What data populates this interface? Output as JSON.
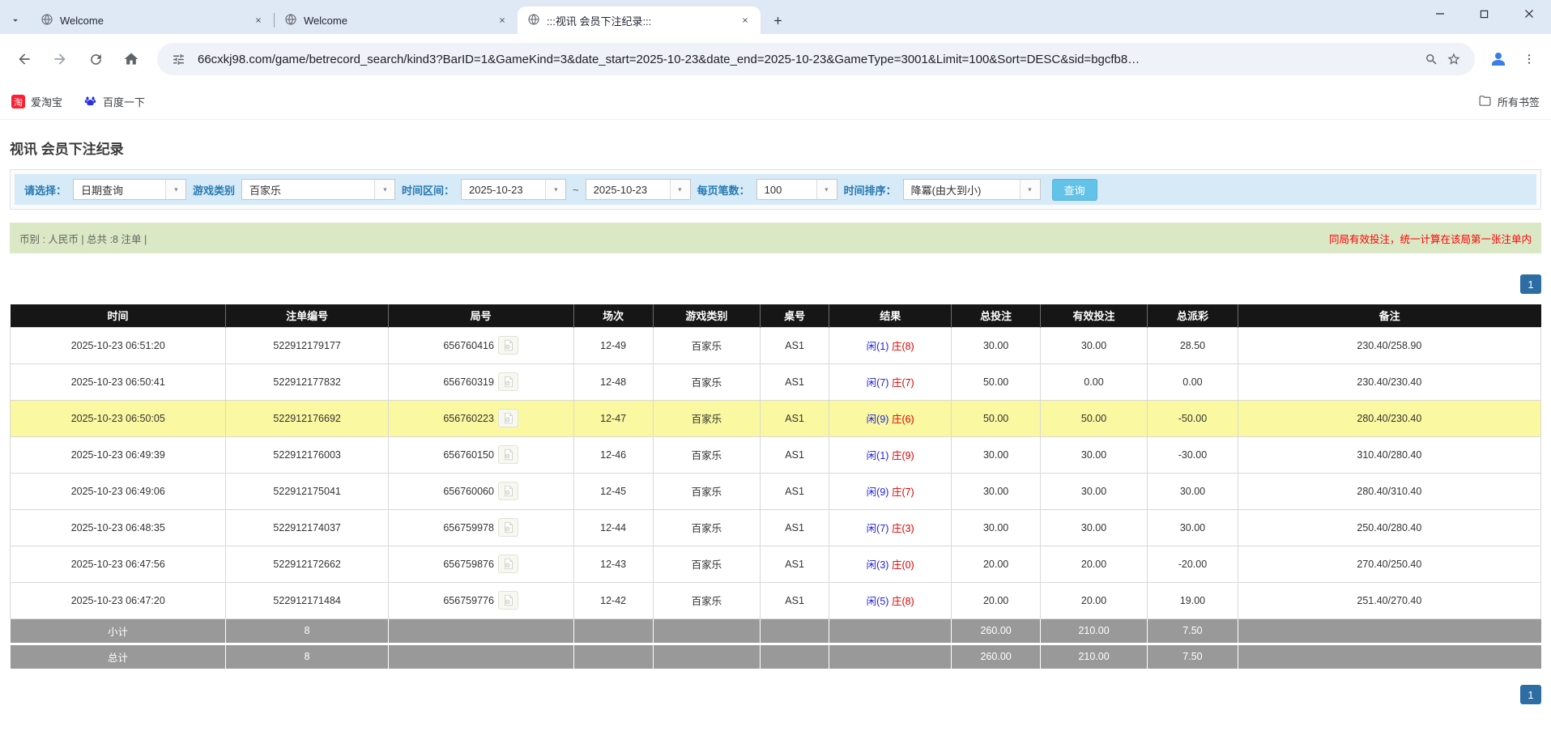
{
  "browser": {
    "tab_list": [
      {
        "title": "Welcome"
      },
      {
        "title": "Welcome"
      },
      {
        "title": ":::视讯 会员下注纪录:::"
      }
    ],
    "url": "66cxkj98.com/game/betrecord_search/kind3?BarID=1&GameKind=3&date_start=2025-10-23&date_end=2025-10-23&GameType=3001&Limit=100&Sort=DESC&sid=bgcfb8…",
    "bookmarks": [
      {
        "label": "爱淘宝",
        "icon_char": "淘"
      },
      {
        "label": "百度一下"
      }
    ],
    "all_bookmarks_label": "所有书签"
  },
  "page": {
    "title": "视讯 会员下注纪录",
    "filters": {
      "select_label": "请选择：",
      "select_value": "日期查询",
      "game_kind_label": "游戏类别",
      "game_kind_value": "百家乐",
      "date_range_label": "时间区间：",
      "date_start": "2025-10-23",
      "date_separator": "~",
      "date_end": "2025-10-23",
      "per_page_label": "每页笔数：",
      "per_page_value": "100",
      "sort_label": "时间排序：",
      "sort_value": "降冪(由大到小)",
      "search_button": "查询"
    },
    "info_bar": {
      "left": "币别 : 人民币 | 总共 :8 注单 |",
      "right": "同局有效投注，统一计算在该局第一张注单内"
    },
    "pagination": "1"
  },
  "table": {
    "headers": [
      "时间",
      "注单编号",
      "局号",
      "场次",
      "游戏类别",
      "桌号",
      "结果",
      "总投注",
      "有效投注",
      "总派彩",
      "备注"
    ],
    "rows": [
      {
        "time": "2025-10-23 06:51:20",
        "bet_id": "522912179177",
        "round": "656760416",
        "session": "12-49",
        "game": "百家乐",
        "table_no": "AS1",
        "result_player": "闲(1)",
        "result_banker": "庄(8)",
        "total_bet": "30.00",
        "valid_bet": "30.00",
        "payout": "28.50",
        "note": "230.40/258.90",
        "highlight": false
      },
      {
        "time": "2025-10-23 06:50:41",
        "bet_id": "522912177832",
        "round": "656760319",
        "session": "12-48",
        "game": "百家乐",
        "table_no": "AS1",
        "result_player": "闲(7)",
        "result_banker": "庄(7)",
        "total_bet": "50.00",
        "valid_bet": "0.00",
        "payout": "0.00",
        "note": "230.40/230.40",
        "highlight": false
      },
      {
        "time": "2025-10-23 06:50:05",
        "bet_id": "522912176692",
        "round": "656760223",
        "session": "12-47",
        "game": "百家乐",
        "table_no": "AS1",
        "result_player": "闲(9)",
        "result_banker": "庄(6)",
        "total_bet": "50.00",
        "valid_bet": "50.00",
        "payout": "-50.00",
        "note": "280.40/230.40",
        "highlight": true
      },
      {
        "time": "2025-10-23 06:49:39",
        "bet_id": "522912176003",
        "round": "656760150",
        "session": "12-46",
        "game": "百家乐",
        "table_no": "AS1",
        "result_player": "闲(1)",
        "result_banker": "庄(9)",
        "total_bet": "30.00",
        "valid_bet": "30.00",
        "payout": "-30.00",
        "note": "310.40/280.40",
        "highlight": false
      },
      {
        "time": "2025-10-23 06:49:06",
        "bet_id": "522912175041",
        "round": "656760060",
        "session": "12-45",
        "game": "百家乐",
        "table_no": "AS1",
        "result_player": "闲(9)",
        "result_banker": "庄(7)",
        "total_bet": "30.00",
        "valid_bet": "30.00",
        "payout": "30.00",
        "note": "280.40/310.40",
        "highlight": false
      },
      {
        "time": "2025-10-23 06:48:35",
        "bet_id": "522912174037",
        "round": "656759978",
        "session": "12-44",
        "game": "百家乐",
        "table_no": "AS1",
        "result_player": "闲(7)",
        "result_banker": "庄(3)",
        "total_bet": "30.00",
        "valid_bet": "30.00",
        "payout": "30.00",
        "note": "250.40/280.40",
        "highlight": false
      },
      {
        "time": "2025-10-23 06:47:56",
        "bet_id": "522912172662",
        "round": "656759876",
        "session": "12-43",
        "game": "百家乐",
        "table_no": "AS1",
        "result_player": "闲(3)",
        "result_banker": "庄(0)",
        "total_bet": "20.00",
        "valid_bet": "20.00",
        "payout": "-20.00",
        "note": "270.40/250.40",
        "highlight": false
      },
      {
        "time": "2025-10-23 06:47:20",
        "bet_id": "522912171484",
        "round": "656759776",
        "session": "12-42",
        "game": "百家乐",
        "table_no": "AS1",
        "result_player": "闲(5)",
        "result_banker": "庄(8)",
        "total_bet": "20.00",
        "valid_bet": "20.00",
        "payout": "19.00",
        "note": "251.40/270.40",
        "highlight": false
      }
    ],
    "subtotal": {
      "label": "小计",
      "count": "8",
      "total_bet": "260.00",
      "valid_bet": "210.00",
      "payout": "7.50"
    },
    "total": {
      "label": "总计",
      "count": "8",
      "total_bet": "260.00",
      "valid_bet": "210.00",
      "payout": "7.50"
    }
  },
  "colors": {
    "header_bg": "#161616",
    "highlight_row": "#faf8a0",
    "info_bar_bg": "#dae8c6",
    "filter_bar_bg": "#d7eaf8",
    "filter_label": "#2779b0",
    "search_button_bg": "#63c2e8",
    "pager_bg": "#2d6da3",
    "sum_row_bg": "#999999",
    "bet_link": "#0066dd",
    "negative": "#ff0000",
    "player_blue": "#2222dd",
    "banker_red": "#e00000"
  }
}
